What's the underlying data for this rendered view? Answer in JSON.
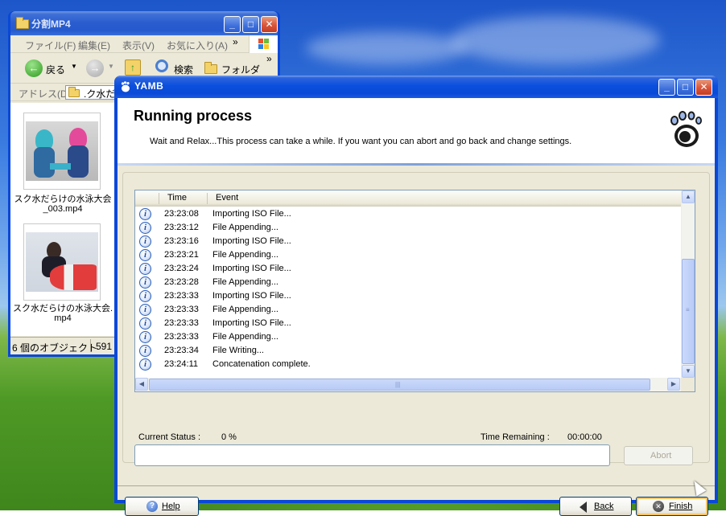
{
  "explorer": {
    "title": "分割MP4",
    "menu": [
      "ファイル(F)",
      "編集(E)",
      "表示(V)",
      "お気に入り(A)"
    ],
    "menu_more": "»",
    "toolbar": {
      "back_label": "戻る",
      "search_label": "検索",
      "folder_label": "フォルダ",
      "more": "»"
    },
    "address_label": "アドレス(D)",
    "address_value": ".ク水だ",
    "files": [
      {
        "name_line1": "スク水だらけの水泳大会",
        "name_line2": "_003.mp4"
      },
      {
        "name_line1": "スク水だらけの水泳大会.",
        "name_line2": "mp4"
      }
    ],
    "status_count": "6 個のオブジェクト",
    "status_size": "591"
  },
  "yamb": {
    "title": "YAMB",
    "header_title": "Running process",
    "header_subtitle": "Wait and Relax...This process can take a while. If you want you can abort and go back and change settings.",
    "columns": {
      "time": "Time",
      "event": "Event"
    },
    "events": [
      {
        "time": "23:23:08",
        "event": "Importing ISO File..."
      },
      {
        "time": "23:23:12",
        "event": "File Appending..."
      },
      {
        "time": "23:23:16",
        "event": "Importing ISO File..."
      },
      {
        "time": "23:23:21",
        "event": "File Appending..."
      },
      {
        "time": "23:23:24",
        "event": "Importing ISO File..."
      },
      {
        "time": "23:23:28",
        "event": "File Appending..."
      },
      {
        "time": "23:23:33",
        "event": "Importing ISO File..."
      },
      {
        "time": "23:23:33",
        "event": "File Appending..."
      },
      {
        "time": "23:23:33",
        "event": "Importing ISO File..."
      },
      {
        "time": "23:23:33",
        "event": "File Appending..."
      },
      {
        "time": "23:23:34",
        "event": "File Writing..."
      },
      {
        "time": "23:24:11",
        "event": "Concatenation complete."
      }
    ],
    "current_status_label": "Current Status :",
    "current_status_value": "0 %",
    "time_remaining_label": "Time Remaining :",
    "time_remaining_value": "00:00:00",
    "progress_fraction": 0,
    "abort_label": "Abort",
    "help_label": "Help",
    "back_label": "Back",
    "finish_label": "Finish"
  },
  "colors": {
    "titlebar_blue": "#0a4ad7",
    "window_face": "#ece9d8",
    "close_red": "#d8553a",
    "info_icon_blue": "#2b5fb8"
  }
}
